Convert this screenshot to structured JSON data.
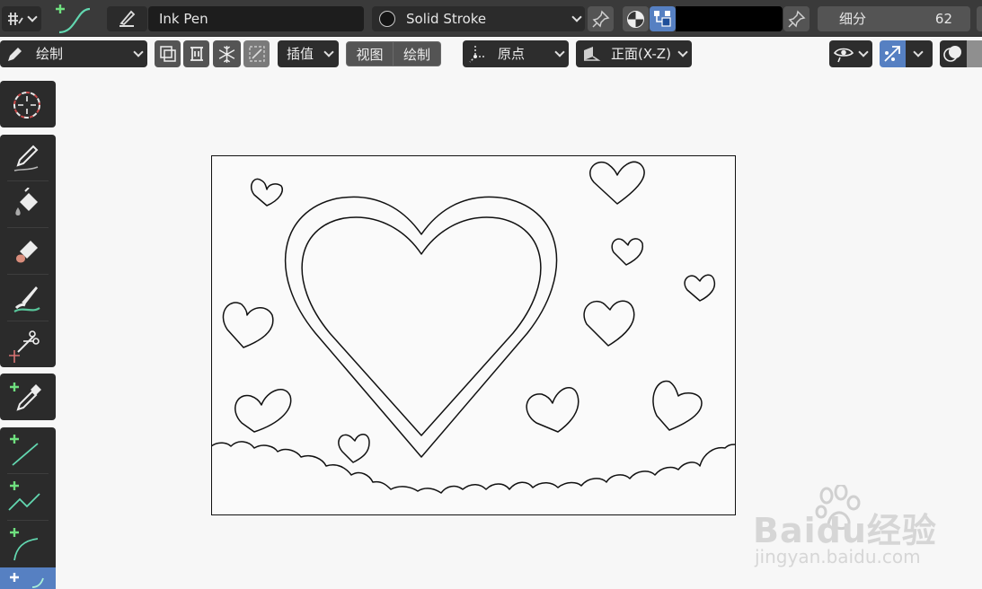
{
  "topbar": {
    "brush_name": "Ink Pen",
    "stroke_material": "Solid Stroke",
    "subdivide_label": "细分",
    "subdivide_value": "62",
    "color_hex": "#000000"
  },
  "toolbar": {
    "mode": "绘制",
    "interpolate": "插值",
    "view_label": "视图",
    "draw_label": "绘制",
    "origin": "原点",
    "drawing_plane": "正面(X-Z)"
  },
  "tools": [
    {
      "name": "cursor",
      "icon": "cursor-icon"
    },
    {
      "name": "draw",
      "icon": "pencil-icon"
    },
    {
      "name": "fill",
      "icon": "bucket-icon"
    },
    {
      "name": "erase",
      "icon": "eraser-icon"
    },
    {
      "name": "tint",
      "icon": "tint-brush-icon"
    },
    {
      "name": "cutter",
      "icon": "scissors-icon"
    },
    {
      "name": "eyedropper",
      "icon": "eyedropper-icon"
    },
    {
      "name": "line",
      "icon": "line-icon"
    },
    {
      "name": "polyline",
      "icon": "polyline-icon"
    },
    {
      "name": "arc",
      "icon": "arc-icon"
    },
    {
      "name": "curve",
      "icon": "curve-icon",
      "active": true
    }
  ],
  "watermark": {
    "brand": "Baidu经验",
    "url": "jingyan.baidu.com"
  },
  "colors": {
    "header_bg": "#3a3a3a",
    "field_bg": "#1d1d1d",
    "accent_blue": "#5680c2",
    "canvas_bg": "#f7f7f7",
    "plus_green": "#6fe07f"
  }
}
